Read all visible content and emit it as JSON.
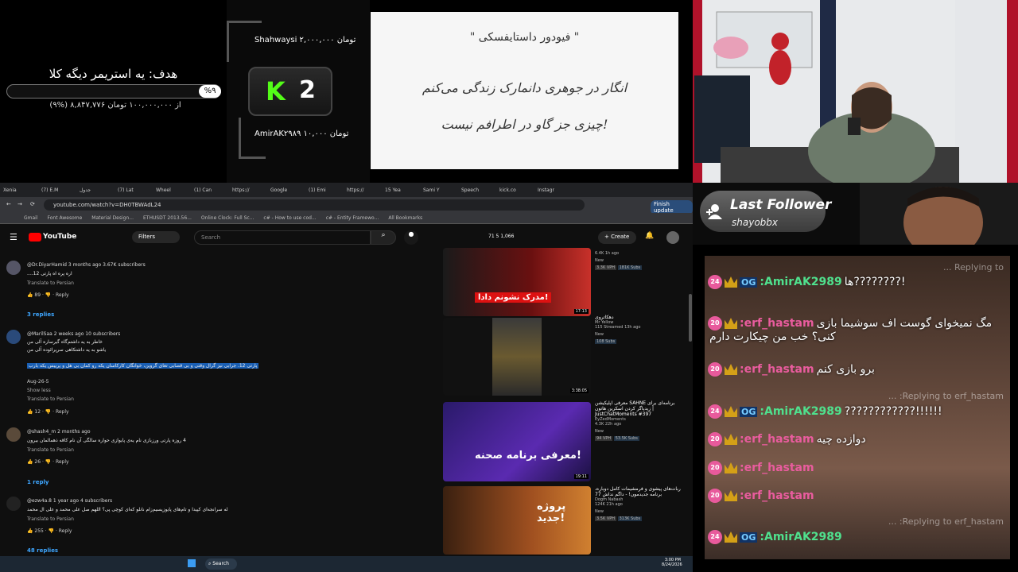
{
  "goal": {
    "title": "هدف: یه استریمر دیگه کلا",
    "percent": "%۹",
    "amount": "(۹%) ۸,۸۴۷,۷۷۶ از ۱۰۰,۰۰۰,۰۰۰ تومان"
  },
  "events": {
    "top": "Shahwaysi ۲,۰۰۰,۰۰۰ تومان",
    "bottom": "AmirAK۲۹۸۹ ۱۰,۰۰۰ تومان",
    "kick_k": "K",
    "kick_count": "2"
  },
  "quote": {
    "author": "\" فیودور داستایفسکی \"",
    "line1": "انگار در جوهری دانمارک زندگی می‌کنم",
    "line2": "چیزی جز گاو در اطرافم نیست!"
  },
  "follower": {
    "title": "Last Follower",
    "name": "shayobbx"
  },
  "browser": {
    "tabs": [
      "Xenia",
      "(7) E.M",
      "جدول",
      "(7) Lat",
      "Wheel",
      "(1) Can",
      "https://",
      "Google",
      "(1) Emi",
      "https://",
      "15 Yea",
      "Sami Y",
      "Speech",
      "kick.co",
      "Instagr"
    ],
    "url": "youtube.com/watch?v=DH0TBWAdL24",
    "bookmarks": [
      "Gmail",
      "Font Awesome",
      "Material Design...",
      "ETHUSDT 2013.56...",
      "Online Clock: Full Sc...",
      "c# - How to use cod...",
      "c# - Entity Framewo...",
      "All Bookmarks"
    ],
    "finish_update": "Finish update"
  },
  "youtube": {
    "logo": "YouTube",
    "filters": "Filters",
    "search_placeholder": "Search",
    "create": "Create",
    "stats": "71  5  1,066",
    "comments": [
      {
        "author": "@Dr.DiyarHamid  3 months ago  3.67K subscribers",
        "text": "اره پره اه پارتی 12....",
        "translate": "Translate to Persian",
        "likes": "89",
        "reply": "Reply",
        "replies": "3 replies"
      },
      {
        "author": "@MarilSaa  2 weeks ago  10 subscribers",
        "text1": "خاطر به یه داشتم‌گاه گیر‌ساره آلی من",
        "text2": "یاشو به یه داشتکاهی سرپرائو‌ده آلی من",
        "text3": "پارتی 12. جرابی نیز گرال وقتی و بی قصابی تعای گروین، خوانگان کارکاسان یکه رو کمان بی هل و پرییس یکه بارب",
        "date": "Aug-26-5",
        "showless": "Show less",
        "translate": "Translate to Persian",
        "likes": "12",
        "reply": "Reply"
      },
      {
        "author": "@shash4_m  2 months ago",
        "text": "4 روزه پارتی ورزبازی نام یه‌ی پایوازی حواره سالگی آن نام کاقه ذهمالمان بیرون",
        "translate": "Translate to Persian",
        "likes": "26",
        "reply": "Reply",
        "replies": "1 reply"
      },
      {
        "author": "@ezw4a.8  1 year ago  4 subscribers",
        "text": "له سرانجه‌ای کپیدا و تام‌های پایوزیسیم‌زا‌م نانلو که‌ای کوچی پی؟ اللهم صل علی محمد و علی ال محمد",
        "translate": "Translate to Persian",
        "likes": "255",
        "reply": "Reply",
        "replies": "48 replies"
      }
    ],
    "videos": [
      {
        "meta": "6.4K  1h ago",
        "badge": "New",
        "vph": "3.3K VPH",
        "subs": "181K Subs",
        "duration": "17:13",
        "caption": "مدرک نشونم دادا!"
      },
      {
        "title": "دهکاتروی",
        "channel": "Mr Yellow",
        "meta": "115  Streamed 13h ago",
        "badge": "New",
        "subs": "108 Subs",
        "duration": "3:38:05"
      },
      {
        "title": "معرفی اپلیکیشن SAHNE برنامه‌ای برای زیدیاگر کردن اسکرین هاتون | JustChatMoments #397",
        "channel": "EyZedMoments",
        "meta": "4.3K  22h ago",
        "badge": "New",
        "vph": "94 VPH",
        "subs": "53.5K Subs",
        "duration": "19:11",
        "caption": "معرفی برنامه صحنه!"
      },
      {
        "title": "ربات‌های پیشوی و فرمشیمات کامل دوباره، برنامه جدیدمون! - داگم نداش 77",
        "channel": "Dogm Nabash",
        "meta": "124K  21h ago",
        "badge": "New",
        "vph": "3.5K VPH",
        "subs": "313K Subs",
        "caption": "پروژه جدید!"
      }
    ]
  },
  "chat": [
    {
      "badge": "24",
      "og": true,
      "user": "AmirAK2989:",
      "text": "!????????ها",
      "color": "green",
      "reply": "Replying to ..."
    },
    {
      "badge": "20",
      "og": false,
      "user": "erf_hastam:",
      "text": "مگ نمیخوای گوست اف سوشیما بازی",
      "text2": "کنی؟ خب من چیکارت دارم",
      "color": "pink"
    },
    {
      "badge": "20",
      "og": false,
      "user": "erf_hastam:",
      "text": "برو بازی کنم",
      "color": "pink",
      "reply": "Replying to erf_hastam: ..."
    },
    {
      "badge": "24",
      "og": true,
      "user": "AmirAK2989:",
      "text": "!!!!!!????????????",
      "color": "green"
    },
    {
      "badge": "20",
      "og": false,
      "user": "erf_hastam:",
      "text": "دوازده چیه",
      "color": "pink"
    },
    {
      "badge": "20",
      "og": false,
      "user": "erf_hastam:",
      "text": "",
      "color": "pink"
    },
    {
      "badge": "20",
      "og": false,
      "user": "erf_hastam:",
      "text": "",
      "color": "pink"
    },
    {
      "badge": "24",
      "og": true,
      "user": "AmirAK2989:",
      "text": "",
      "color": "green",
      "reply": "Replying to erf_hastam: ..."
    }
  ],
  "taskbar": {
    "search": "Search",
    "time": "3:00 PM",
    "date": "8/24/2026"
  },
  "colors": {
    "kick_green": "#53fc18",
    "chat_green": "#4fe08d",
    "chat_pink": "#e95c9e",
    "badge_pink": "#e85a9c"
  }
}
